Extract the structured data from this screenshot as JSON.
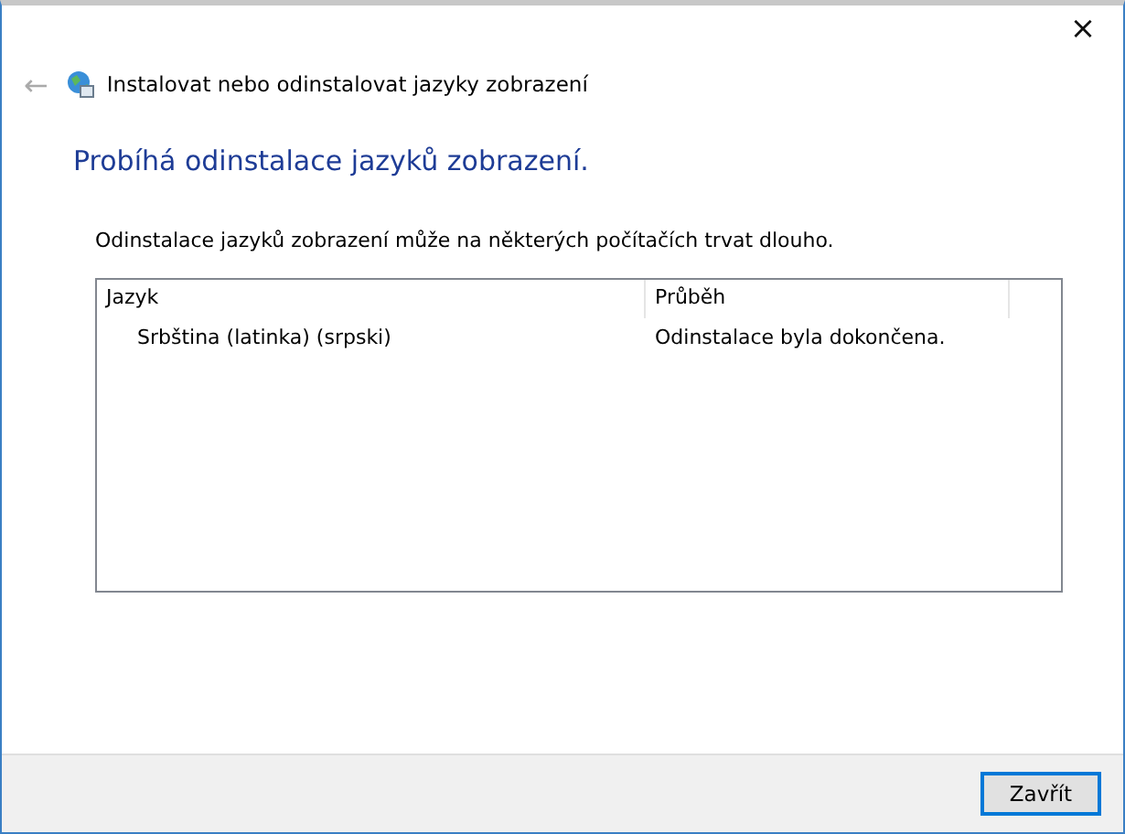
{
  "window": {
    "close": "×",
    "back": "←",
    "title": "Instalovat nebo odinstalovat jazyky zobrazení"
  },
  "heading": "Probíhá odinstalace jazyků zobrazení.",
  "description": "Odinstalace jazyků zobrazení může na některých počítačích trvat dlouho.",
  "table": {
    "columns": [
      "Jazyk",
      "Průběh"
    ],
    "rows": [
      {
        "cells": [
          "Srbština (latinka) (srpski)",
          "Odinstalace byla dokončena."
        ]
      }
    ]
  },
  "buttons": [
    {
      "label": "Zavřít",
      "default": true
    }
  ]
}
